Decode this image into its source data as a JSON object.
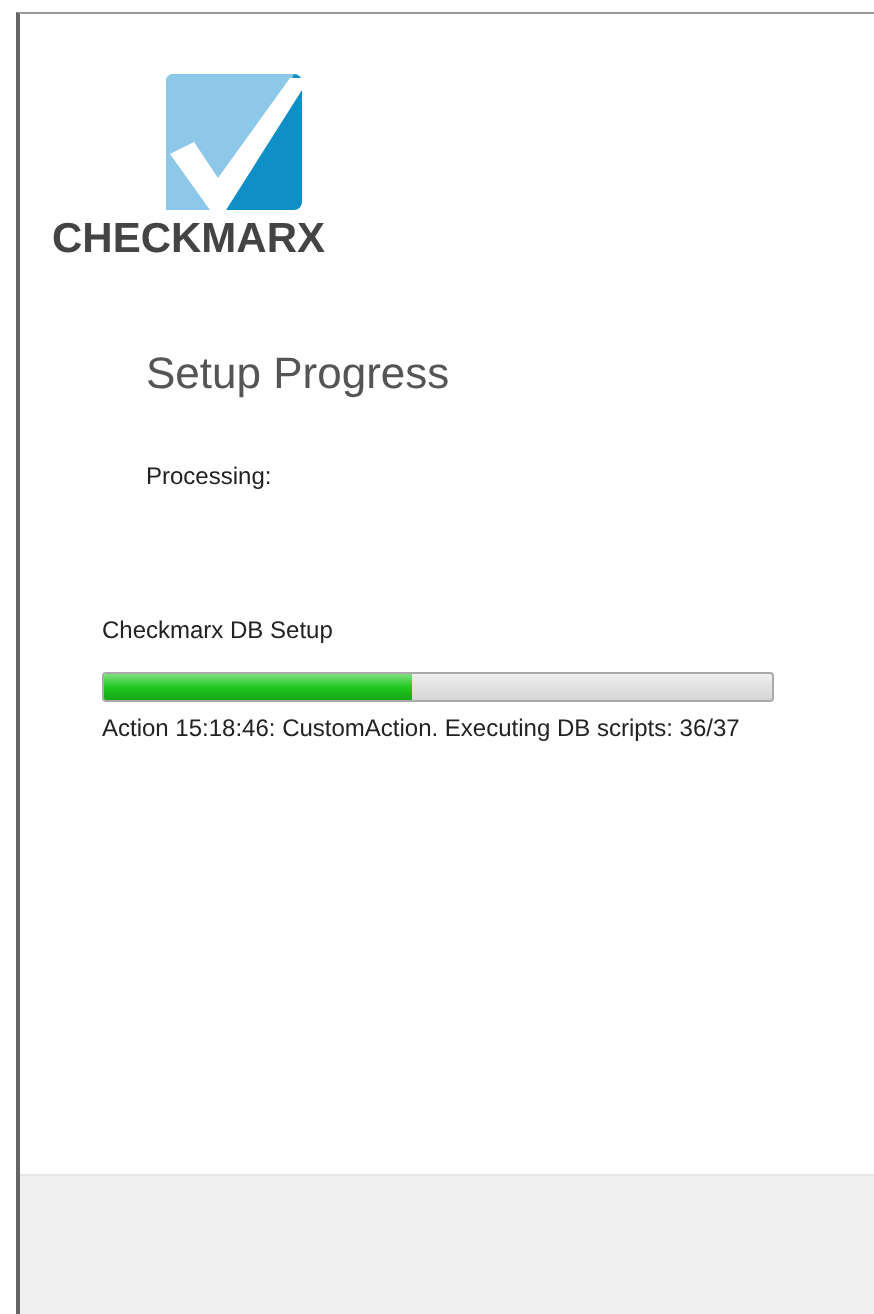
{
  "logo": {
    "text": "CHECKMARX"
  },
  "title": "Setup Progress",
  "status_label": "Processing:",
  "component": "Checkmarx DB Setup",
  "progress": {
    "level": 0.46
  },
  "action": "Action 15:18:46: CustomAction. Executing DB scripts: 36/37"
}
